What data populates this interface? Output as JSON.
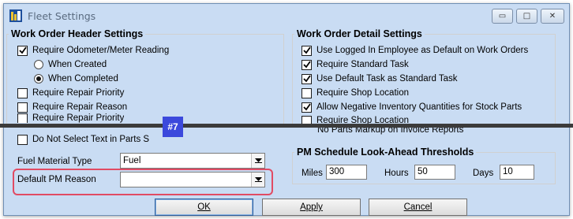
{
  "window": {
    "title": "Fleet Settings",
    "controls": {
      "minimize": "▭",
      "maximize": "□",
      "close": "✕"
    }
  },
  "header_settings": {
    "legend": "Work Order Header Settings",
    "items": [
      {
        "label": "Require Odometer/Meter Reading",
        "type": "checkbox",
        "checked": true
      },
      {
        "label": "When Created",
        "type": "radio",
        "checked": false
      },
      {
        "label": "When Completed",
        "type": "radio",
        "checked": true
      },
      {
        "label": "Require Repair Priority",
        "type": "checkbox",
        "checked": false
      },
      {
        "label": "Require Repair Reason",
        "type": "checkbox",
        "checked": false
      },
      {
        "label": "Require Repair Priority",
        "type": "checkbox",
        "checked": false
      },
      {
        "label": "Do Not Select Text in Parts S",
        "type": "checkbox",
        "checked": false
      }
    ]
  },
  "detail_settings": {
    "legend": "Work Order Detail Settings",
    "items": [
      {
        "label": "Use Logged In Employee as Default on Work Orders",
        "checked": true
      },
      {
        "label": "Require Standard Task",
        "checked": true
      },
      {
        "label": "Use Default Task as Standard Task",
        "checked": true
      },
      {
        "label": "Require Shop Location",
        "checked": false
      },
      {
        "label": "Allow Negative Inventory Quantities for Stock Parts",
        "checked": true
      },
      {
        "label": "Require Shop Location",
        "checked": false
      },
      {
        "label": "No Parts Markup on Invoice Reports",
        "checked": false
      }
    ]
  },
  "badge": "#7",
  "fuel_material_type": {
    "label": "Fuel Material Type",
    "value": "Fuel"
  },
  "default_pm_reason": {
    "label": "Default PM Reason",
    "value": ""
  },
  "pm_thresholds": {
    "legend": "PM Schedule Look-Ahead Thresholds",
    "miles_label": "Miles",
    "miles_value": "300",
    "hours_label": "Hours",
    "hours_value": "50",
    "days_label": "Days",
    "days_value": "10"
  },
  "buttons": {
    "ok": "OK",
    "apply": "Apply",
    "cancel": "Cancel"
  }
}
